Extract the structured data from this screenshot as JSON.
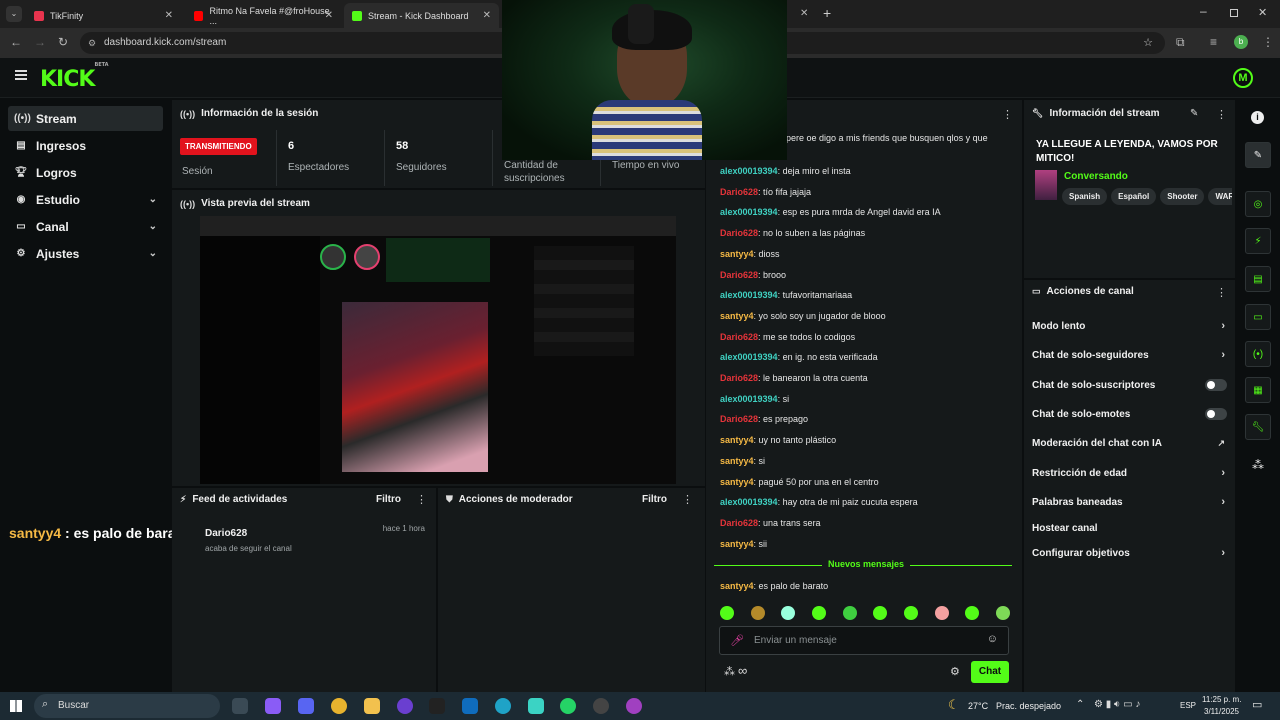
{
  "browser": {
    "tabs": [
      {
        "label": "TikFinity",
        "color": "#e8344e"
      },
      {
        "label": "Ritmo Na Favela #@froHouse ...",
        "color": "#ff0000"
      },
      {
        "label": "Stream - Kick Dashboard",
        "color": "#53fc18"
      }
    ],
    "url": "dashboard.kick.com/stream",
    "profile_initial": "b"
  },
  "kick": {
    "logo": "KICK",
    "logo_sup": "BETA",
    "avatar_initial": "M"
  },
  "sidebar": {
    "items": [
      {
        "label": "Stream",
        "icon": "stream-icon"
      },
      {
        "label": "Ingresos",
        "icon": "money-icon"
      },
      {
        "label": "Logros",
        "icon": "trophy-icon"
      },
      {
        "label": "Estudio",
        "icon": "studio-icon"
      },
      {
        "label": "Canal",
        "icon": "channel-icon"
      },
      {
        "label": "Ajustes",
        "icon": "gear-icon"
      }
    ]
  },
  "session": {
    "title": "Información de la sesión",
    "badge": "TRANSMITIENDO",
    "badge_label": "Sesión",
    "stats": [
      {
        "num": "6",
        "label": "Espectadores"
      },
      {
        "num": "58",
        "label": "Seguidores"
      },
      {
        "num": "",
        "label": "Cantidad de suscripciones"
      },
      {
        "num": "",
        "label": "Tiempo en vivo"
      }
    ]
  },
  "preview": {
    "title": "Vista previa del stream"
  },
  "overlay_chat": {
    "user": "santyy4",
    "text": " : es palo de barato"
  },
  "activity": {
    "title": "Feed de actividades",
    "filter": "Filtro",
    "item_user": "Dario628",
    "item_text": "acaba de seguir el canal",
    "item_time": "hace 1 hora"
  },
  "moderator": {
    "title": "Acciones de moderador",
    "filter": "Filtro"
  },
  "chat": {
    "partial": "pere oe digo a mis friends que busquen qlos y que",
    "messages": [
      {
        "user": "alex00019394",
        "text": ": deja miro el insta",
        "color": "#3fd1c2"
      },
      {
        "user": "Dario628",
        "text": ": tío fifa jajaja",
        "color": "#e5343a"
      },
      {
        "user": "alex00019394",
        "text": ": esp es pura mrda de Angel david era IA",
        "color": "#3fd1c2"
      },
      {
        "user": "Dario628",
        "text": ": no lo suben a las páginas",
        "color": "#e5343a"
      },
      {
        "user": "santyy4",
        "text": ": dioss",
        "color": "#f5b945"
      },
      {
        "user": "Dario628",
        "text": ": brooo",
        "color": "#e5343a"
      },
      {
        "user": "alex00019394",
        "text": ": tufavoritamariaaa",
        "color": "#3fd1c2"
      },
      {
        "user": "santyy4",
        "text": ": yo solo soy un jugador de blooo",
        "color": "#f5b945"
      },
      {
        "user": "Dario628",
        "text": ": me se todos lo codigos",
        "color": "#e5343a"
      },
      {
        "user": "alex00019394",
        "text": ": en ig. no esta verificada",
        "color": "#3fd1c2"
      },
      {
        "user": "Dario628",
        "text": ": le banearon la otra cuenta",
        "color": "#e5343a"
      },
      {
        "user": "alex00019394",
        "text": ": si",
        "color": "#3fd1c2"
      },
      {
        "user": "Dario628",
        "text": ": es prepago",
        "color": "#e5343a"
      },
      {
        "user": "santyy4",
        "text": ": uy no tanto plástico",
        "color": "#f5b945"
      },
      {
        "user": "santyy4",
        "text": ": si",
        "color": "#f5b945"
      },
      {
        "user": "santyy4",
        "text": ": pagué 50 por una en el centro",
        "color": "#f5b945"
      },
      {
        "user": "alex00019394",
        "text": ": hay otra de mi paiz cucuta espera",
        "color": "#3fd1c2"
      },
      {
        "user": "Dario628",
        "text": ": una trans sera",
        "color": "#e5343a"
      },
      {
        "user": "santyy4",
        "text": ": sii",
        "color": "#f5b945"
      }
    ],
    "new_divider": "Nuevos mensajes",
    "new_message": {
      "user": "santyy4",
      "text": ": es palo de barato",
      "color": "#f5b945"
    },
    "input_placeholder": "Enviar un mensaje",
    "send_label": "Chat",
    "points": "∞"
  },
  "stream_info": {
    "title": "Información del stream",
    "stream_title": "YA LLEGUE A LEYENDA, VAMOS POR MITICO!",
    "category": "Conversando",
    "tags": [
      "Spanish",
      "Español",
      "Shooter",
      "WAR"
    ]
  },
  "channel_actions": {
    "title": "Acciones de canal",
    "items": [
      {
        "label": "Modo lento",
        "kind": "chevron"
      },
      {
        "label": "Chat de solo-seguidores",
        "kind": "chevron"
      },
      {
        "label": "Chat de solo-suscriptores",
        "kind": "toggle"
      },
      {
        "label": "Chat de solo-emotes",
        "kind": "toggle"
      },
      {
        "label": "Moderación del chat con IA",
        "kind": "external"
      },
      {
        "label": "Restricción de edad",
        "kind": "chevron"
      },
      {
        "label": "Palabras baneadas",
        "kind": "chevron"
      },
      {
        "label": "Hostear canal",
        "kind": "none"
      },
      {
        "label": "Configurar objetivos",
        "kind": "chevron"
      }
    ]
  },
  "taskbar": {
    "search": "Buscar",
    "weather_temp": "27°C",
    "weather_text": "Prac. despejado",
    "lang": "ESP",
    "time": "11:25 p. m.",
    "date": "3/11/2025"
  },
  "colors": {
    "accent": "#53fc18",
    "live": "#e2131d"
  }
}
